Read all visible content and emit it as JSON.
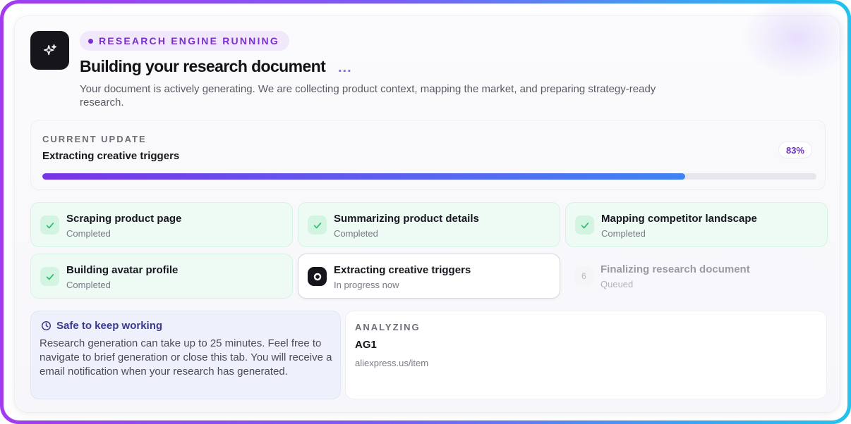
{
  "header": {
    "badge": "RESEARCH ENGINE RUNNING",
    "title": "Building your research document",
    "title_dots": "...",
    "subtitle": "Your document is actively generating. We are collecting product context, mapping the market, and preparing strategy-ready research."
  },
  "current_update": {
    "label": "CURRENT UPDATE",
    "text": "Extracting creative triggers",
    "percent_label": "83%",
    "progress": 0.83
  },
  "steps": [
    {
      "name": "Scraping product page",
      "status": "Completed",
      "state": "done"
    },
    {
      "name": "Summarizing product details",
      "status": "Completed",
      "state": "done"
    },
    {
      "name": "Mapping competitor landscape",
      "status": "Completed",
      "state": "done"
    },
    {
      "name": "Building avatar profile",
      "status": "Completed",
      "state": "done"
    },
    {
      "name": "Extracting creative triggers",
      "status": "In progress now",
      "state": "active"
    },
    {
      "name": "Finalizing research document",
      "status": "Queued",
      "state": "queued",
      "number": "6"
    }
  ],
  "notice": {
    "title": "Safe to keep working",
    "body": "Research generation can take up to 25 minutes. Feel free to navigate to brief generation or close this tab. You will receive a email notification when your research has generated."
  },
  "analyzing": {
    "label": "ANALYZING",
    "name": "AG1",
    "url": "aliexpress.us/item"
  },
  "colors": {
    "accent": "#7b2fcf",
    "success": "#2fbf71",
    "frame_start": "#a23bf0",
    "frame_end": "#24c2ec"
  },
  "icons": {
    "app": "sparkles-icon",
    "done": "check-icon",
    "active": "record-icon",
    "notice": "clock-icon"
  }
}
